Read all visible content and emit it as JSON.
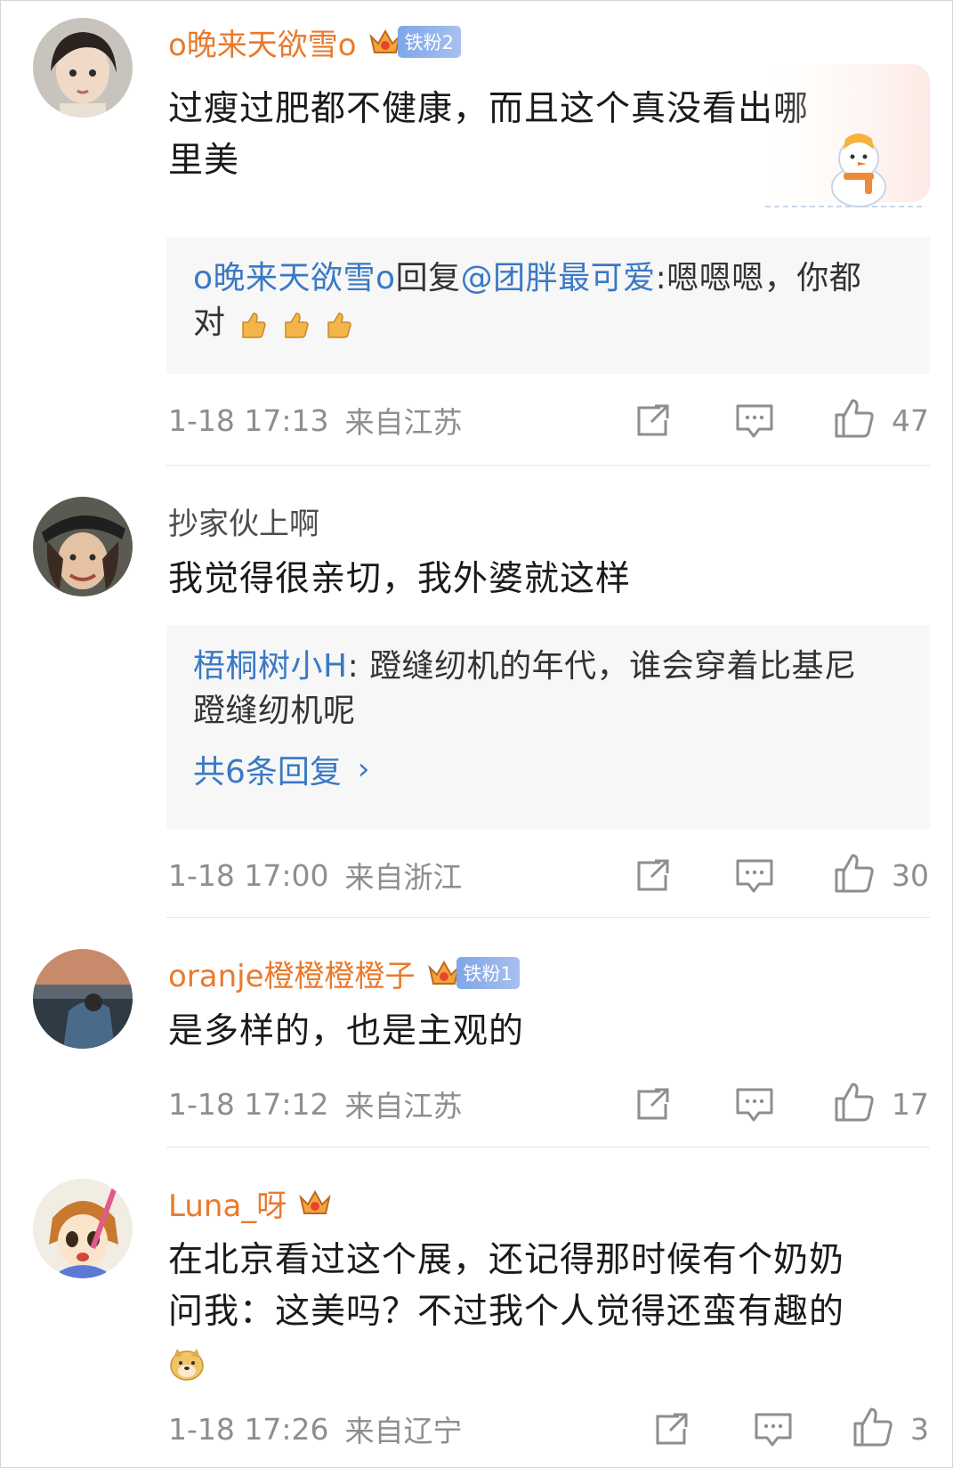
{
  "comments": [
    {
      "username": "o晚来天欲雪o",
      "fan_badge": "铁粉2",
      "text_line1": "过瘦过肥都不健康，而且这个真没看出哪",
      "text_line2": "里美",
      "reply": {
        "author": "o晚来天欲雪o",
        "reply_word": "回复",
        "mention": "@团胖最可爱",
        "text_line1_rest": ":嗯嗯嗯，你都",
        "text_line2": "对"
      },
      "time": "1-18 17:13",
      "location": "来自江苏",
      "likes": "47"
    },
    {
      "username": "抄家伙上啊",
      "text": "我觉得很亲切，我外婆就这样",
      "reply": {
        "author": "梧桐树小H",
        "text_line1_rest": ": 蹬缝纫机的年代，谁会穿着比基尼",
        "text_line2": "蹬缝纫机呢",
        "more_label": "共6条回复",
        "more_chevron": "›"
      },
      "time": "1-18 17:00",
      "location": "来自浙江",
      "likes": "30"
    },
    {
      "username": "oranje橙橙橙橙子",
      "fan_badge": "铁粉1",
      "text": "是多样的，也是主观的",
      "time": "1-18 17:12",
      "location": "来自江苏",
      "likes": "17"
    },
    {
      "username": "Luna_呀",
      "text_line1": "在北京看过这个展，还记得那时候有个奶奶",
      "text_line2": "问我：这美吗？不过我个人觉得还蛮有趣的",
      "time": "1-18 17:26",
      "location": "来自辽宁",
      "likes": "3"
    }
  ],
  "colors": {
    "username": "#ea7a2b",
    "link_blue": "#3a79c5",
    "meta_gray": "#8e8e8e",
    "reply_bg": "#f7f7f7",
    "fan_badge": "#7ea6e8"
  },
  "icons": [
    "share-icon",
    "comment-icon",
    "like-icon",
    "crown-icon",
    "thumbs-up-emoji",
    "doge-emoji",
    "snowman-decoration"
  ]
}
